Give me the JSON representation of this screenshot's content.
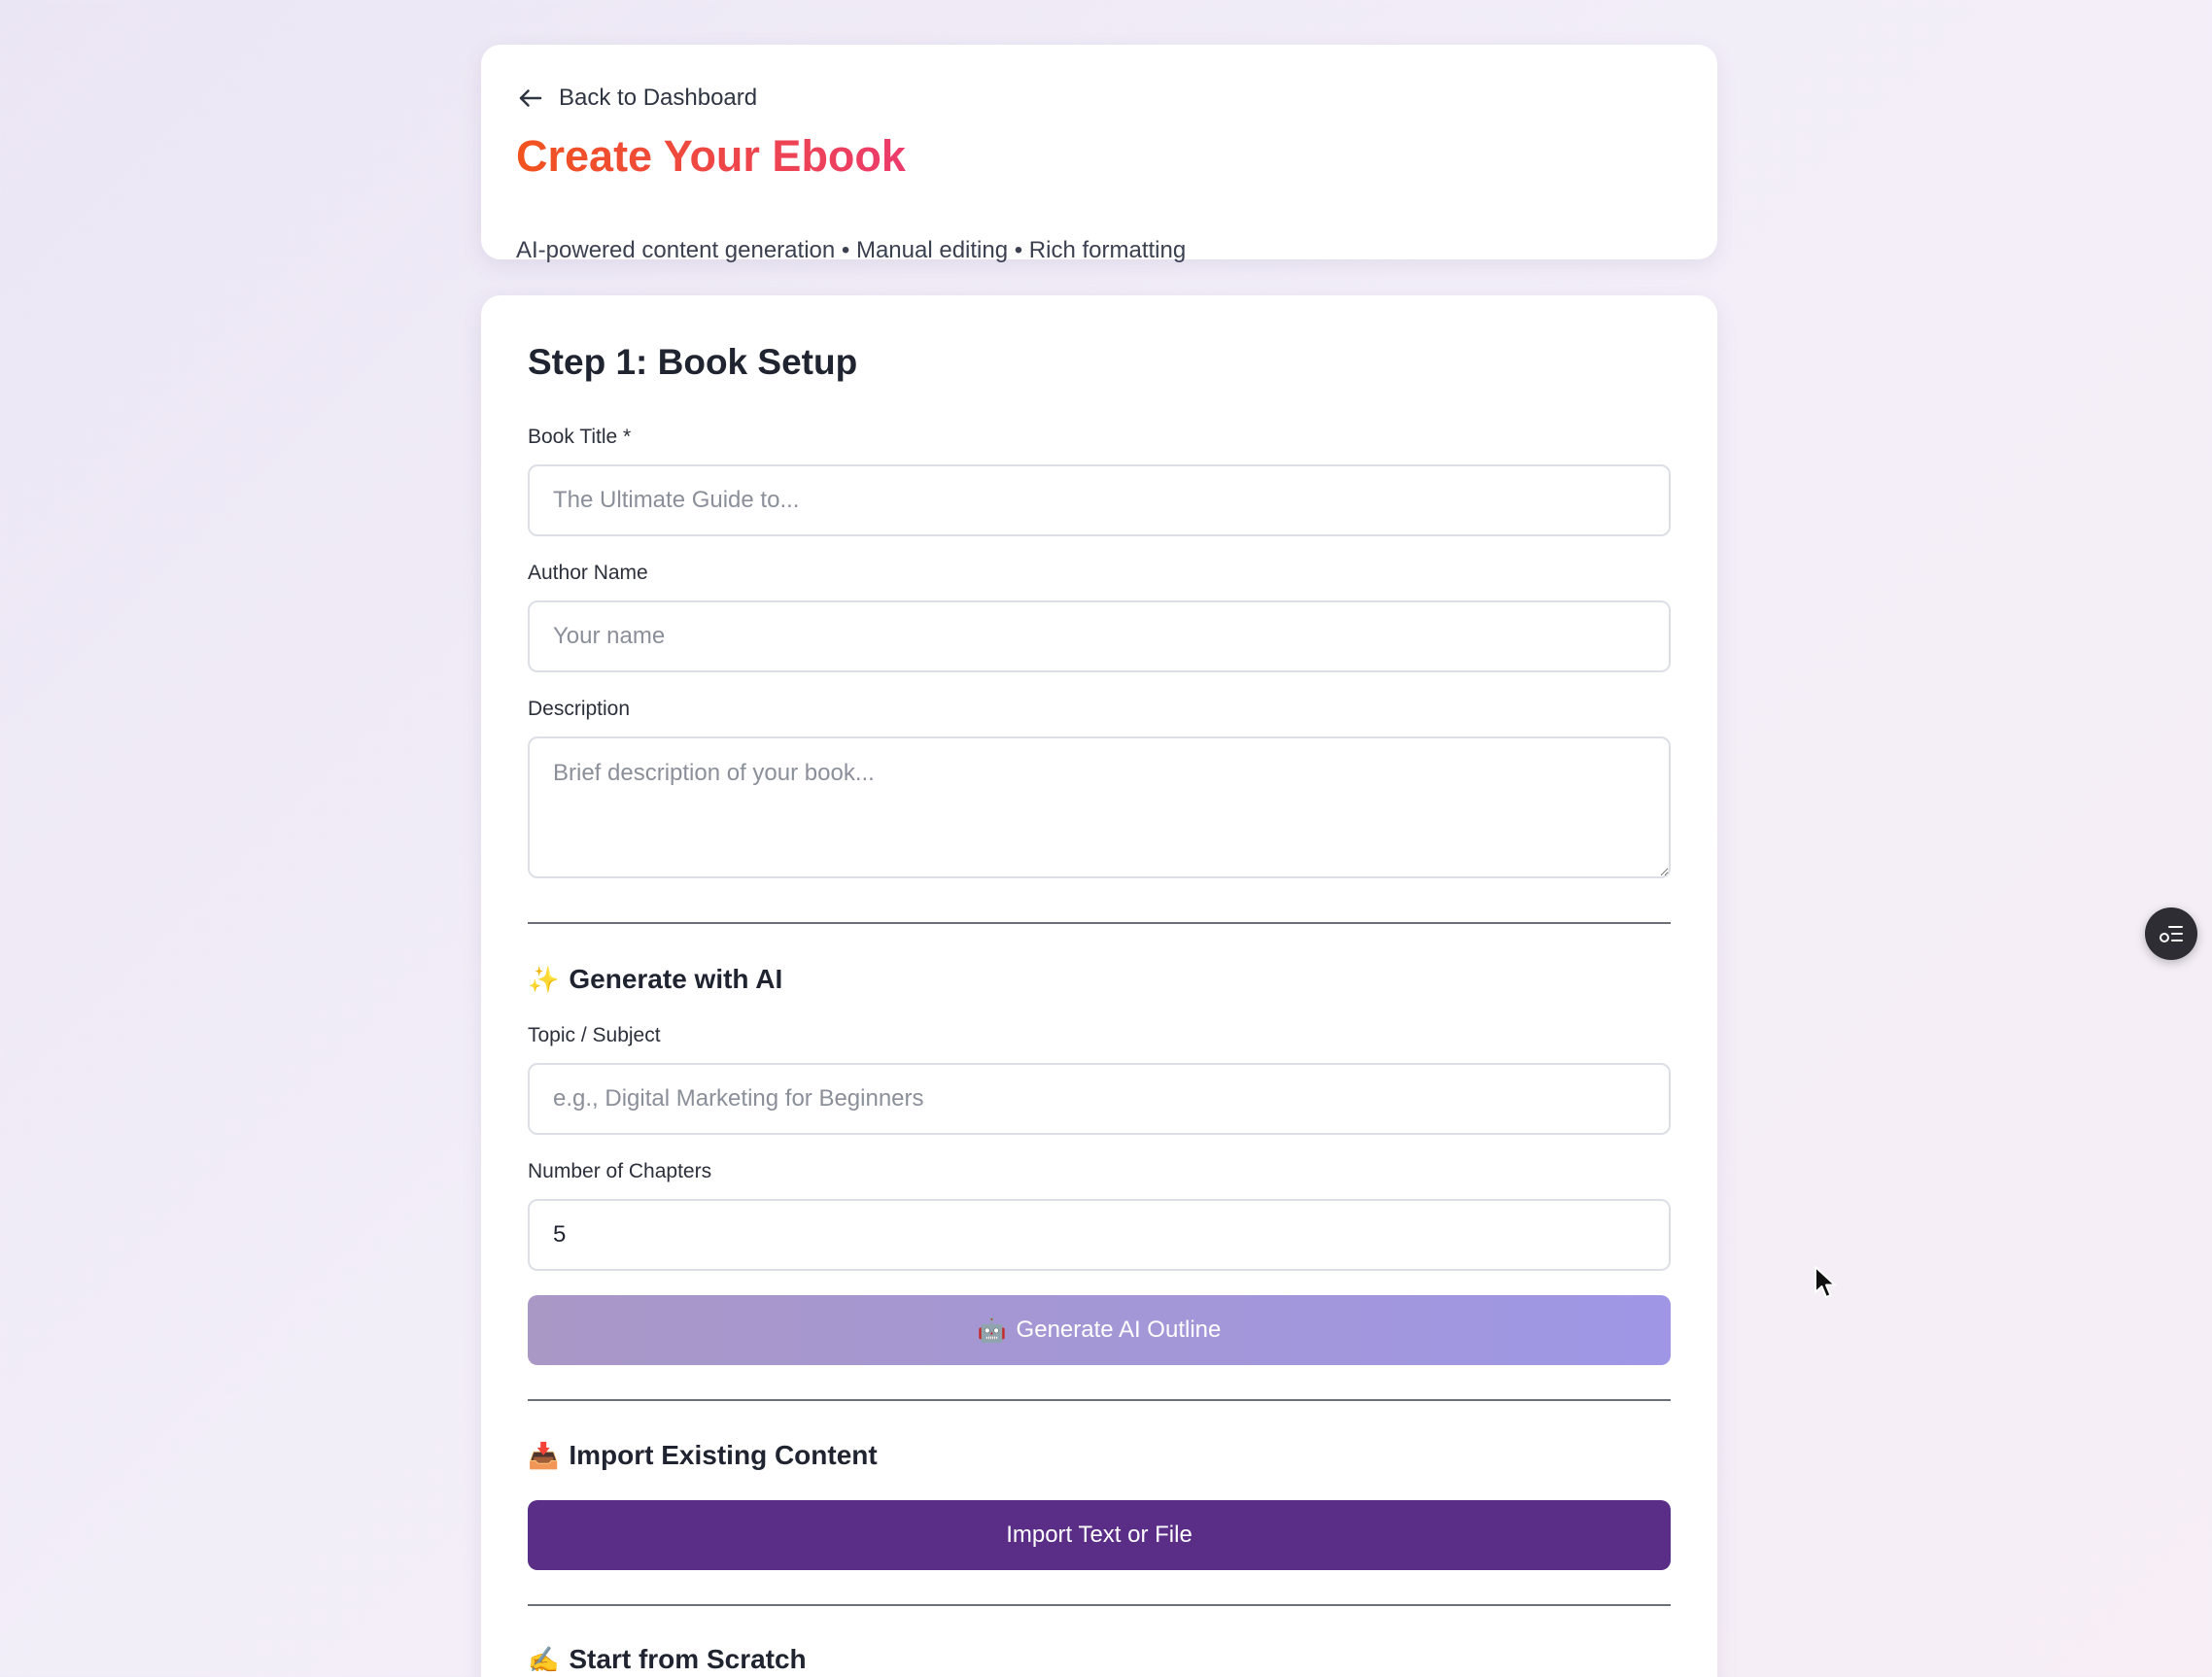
{
  "header": {
    "back_label": "Back to Dashboard",
    "title": "Create Your Ebook",
    "subtitle": "AI-powered content generation • Manual editing • Rich formatting"
  },
  "setup": {
    "step_title": "Step 1: Book Setup",
    "book_title_label": "Book Title *",
    "book_title_placeholder": "The Ultimate Guide to...",
    "book_title_value": "",
    "author_label": "Author Name",
    "author_placeholder": "Your name",
    "author_value": "",
    "description_label": "Description",
    "description_placeholder": "Brief description of your book...",
    "description_value": ""
  },
  "ai": {
    "emoji": "✨",
    "title": "Generate with AI",
    "topic_label": "Topic / Subject",
    "topic_placeholder": "e.g., Digital Marketing for Beginners",
    "topic_value": "",
    "chapters_label": "Number of Chapters",
    "chapters_value": "5",
    "button_emoji": "🤖",
    "button_label": "Generate AI Outline",
    "button_gradient": [
      "#a997c6",
      "#9f97e6"
    ]
  },
  "import": {
    "emoji": "📥",
    "title": "Import Existing Content",
    "button_label": "Import Text or File",
    "button_color": "#5a2d87"
  },
  "scratch": {
    "emoji": "✍️",
    "title": "Start from Scratch"
  },
  "title_gradient": [
    "#f1531d",
    "#ec3b6c"
  ],
  "icons": {
    "back": "arrow-left-icon",
    "floating": "list-settings-icon",
    "cursor": "mouse-pointer-icon"
  }
}
